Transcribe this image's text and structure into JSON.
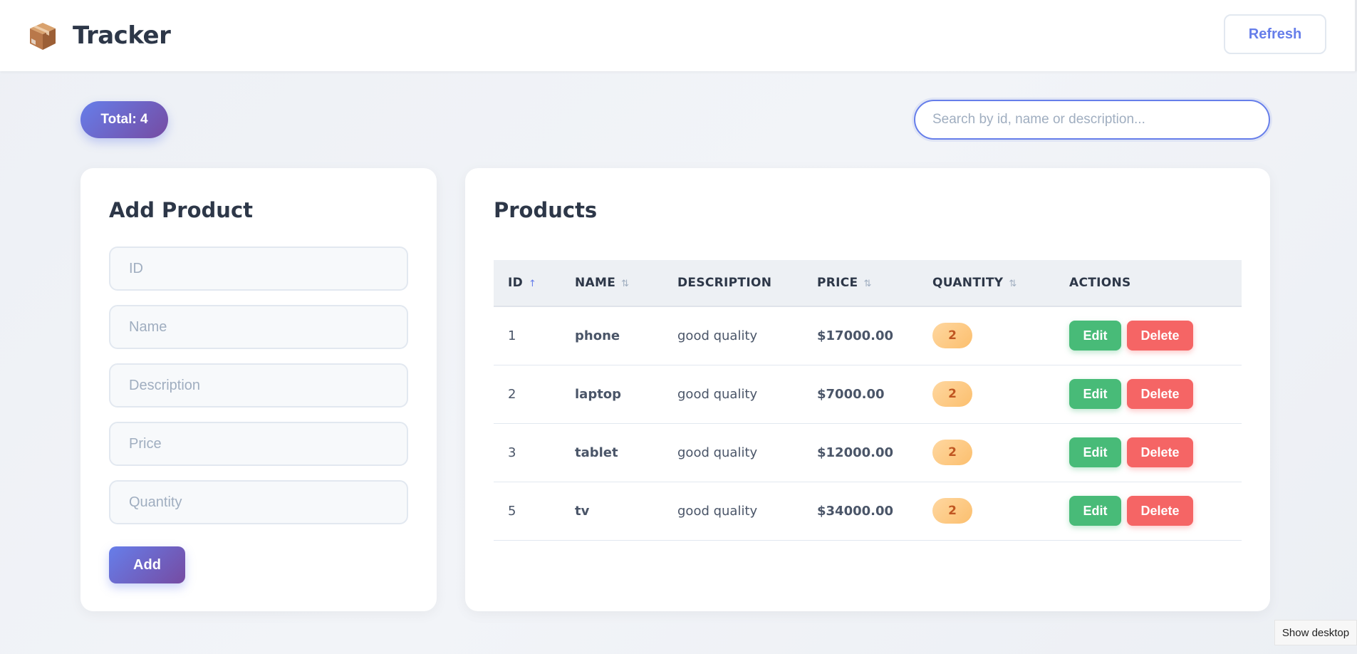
{
  "header": {
    "logo_icon": "package-box-icon",
    "title": "Tracker",
    "refresh_label": "Refresh"
  },
  "toolbar": {
    "total_label": "Total: 4",
    "search_placeholder": "Search by id, name or description...",
    "search_value": ""
  },
  "add_form": {
    "title": "Add Product",
    "fields": [
      {
        "placeholder": "ID",
        "value": ""
      },
      {
        "placeholder": "Name",
        "value": ""
      },
      {
        "placeholder": "Description",
        "value": ""
      },
      {
        "placeholder": "Price",
        "value": ""
      },
      {
        "placeholder": "Quantity",
        "value": ""
      }
    ],
    "submit_label": "Add"
  },
  "products": {
    "title": "Products",
    "columns": [
      {
        "label": "ID",
        "sort": "↑",
        "sort_active": true
      },
      {
        "label": "NAME",
        "sort": "⇅",
        "sort_active": false
      },
      {
        "label": "DESCRIPTION",
        "sort": "",
        "sort_active": false
      },
      {
        "label": "PRICE",
        "sort": "⇅",
        "sort_active": false
      },
      {
        "label": "QUANTITY",
        "sort": "⇅",
        "sort_active": false
      },
      {
        "label": "ACTIONS",
        "sort": "",
        "sort_active": false
      }
    ],
    "rows": [
      {
        "id": "1",
        "name": "phone",
        "description": "good quality",
        "price": "$17000.00",
        "quantity": "2"
      },
      {
        "id": "2",
        "name": "laptop",
        "description": "good quality",
        "price": "$7000.00",
        "quantity": "2"
      },
      {
        "id": "3",
        "name": "tablet",
        "description": "good quality",
        "price": "$12000.00",
        "quantity": "2"
      },
      {
        "id": "5",
        "name": "tv",
        "description": "good quality",
        "price": "$34000.00",
        "quantity": "2"
      }
    ],
    "edit_label": "Edit",
    "delete_label": "Delete"
  },
  "taskbar": {
    "show_desktop_label": "Show desktop"
  },
  "colors": {
    "accent_start": "#667eea",
    "accent_end": "#764ba2",
    "edit": "#48bb78",
    "delete": "#f56565",
    "quantity_badge": "#fcbf6e"
  }
}
